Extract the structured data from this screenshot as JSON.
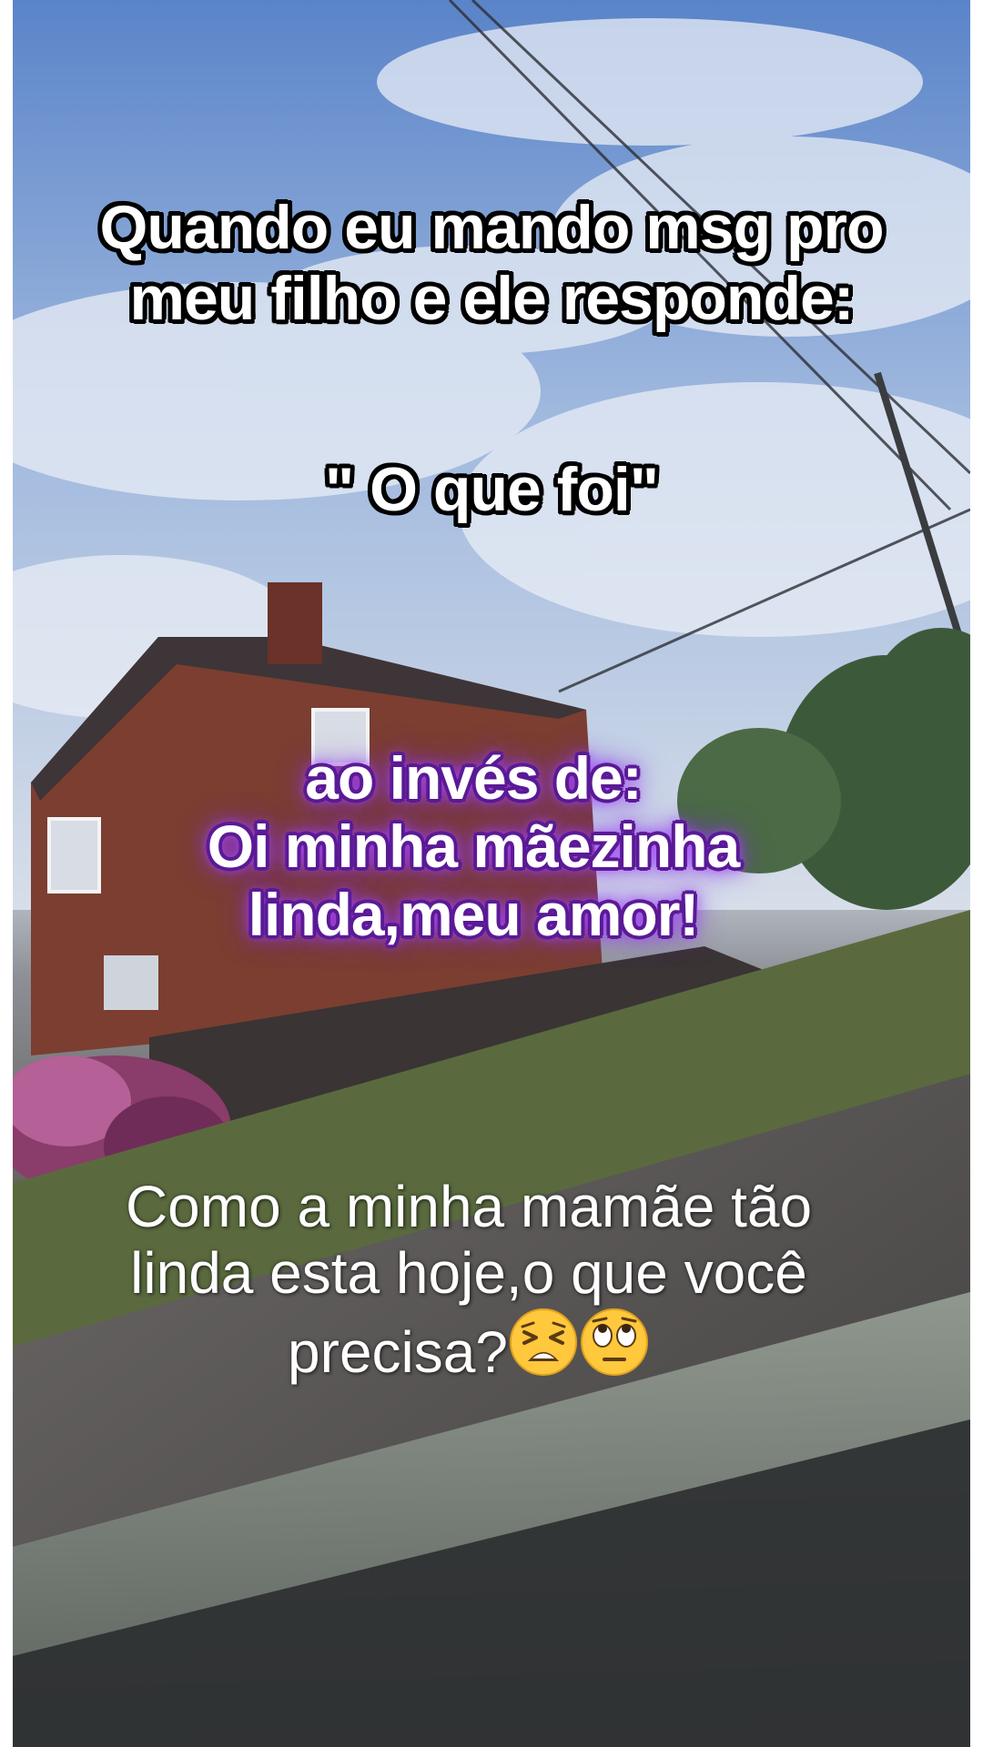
{
  "captions": {
    "top": {
      "line1": "Quando eu mando msg pro",
      "line2": "meu filho e ele responde:",
      "quote": "\" O que foi\""
    },
    "middle": {
      "line1": "ao invés de:",
      "line2": "Oi minha mãezinha",
      "line3": "linda,meu amor!"
    },
    "bottom": {
      "line1": "Como a minha mamãe tão",
      "line2": "linda esta hoje,o que você",
      "line3": "precisa?",
      "emojis": [
        "tired-face-emoji",
        "face-with-rolling-eyes-emoji"
      ]
    }
  },
  "colors": {
    "sky": "#7fa2d4",
    "brick": "#8a4a3a",
    "glow": "#9b3dff",
    "outline": "#000000"
  }
}
